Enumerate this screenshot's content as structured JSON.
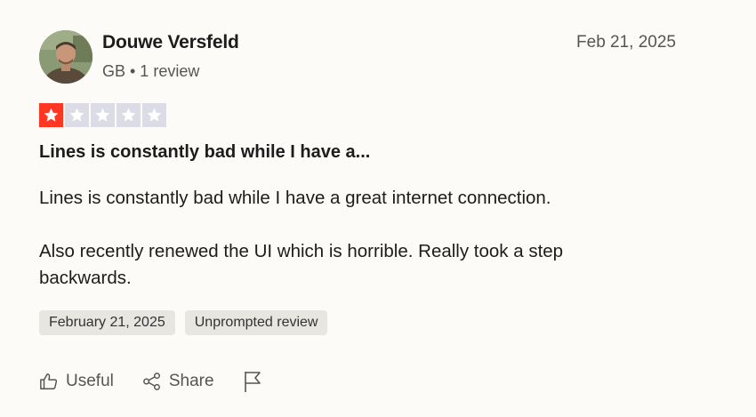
{
  "reviewer": {
    "name": "Douwe Versfeld",
    "meta": "GB • 1 review",
    "avatar_icon": "user-photo"
  },
  "review": {
    "date": "Feb 21, 2025",
    "rating": 1,
    "max_rating": 5,
    "title": "Lines is constantly bad while I have a...",
    "body": [
      "Lines is constantly bad while I have a great internet connection.",
      "Also recently renewed the UI which is horrible. Really took a step backwards."
    ],
    "tags": [
      "February 21, 2025",
      "Unprompted review"
    ]
  },
  "actions": {
    "useful_label": "Useful",
    "share_label": "Share",
    "useful_icon": "thumbs-up-icon",
    "share_icon": "share-icon",
    "report_icon": "flag-icon"
  },
  "colors": {
    "star_filled": "#ff3722",
    "star_empty": "#dcdce6",
    "tag_bg": "#e8e6e1",
    "background": "#fcfbf8"
  }
}
